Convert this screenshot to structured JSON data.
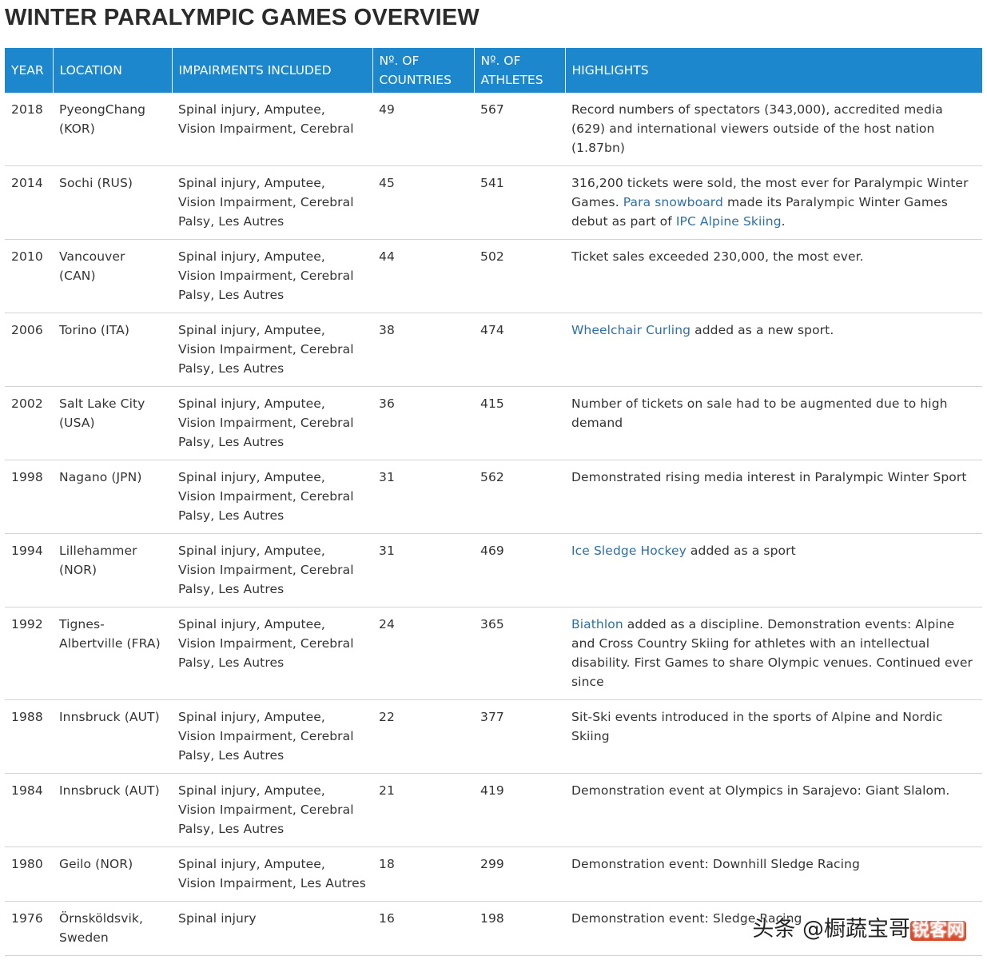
{
  "page": {
    "title": "WINTER PARALYMPIC GAMES OVERVIEW"
  },
  "table": {
    "headers": {
      "year": "YEAR",
      "location": "LOCATION",
      "impairments": "IMPAIRMENTS INCLUDED",
      "countries_line1": "Nº. OF",
      "countries_line2": "COUNTRIES",
      "athletes_line1": "Nº. OF",
      "athletes_line2": "ATHLETES",
      "highlights": "HIGHLIGHTS"
    },
    "rows": [
      {
        "year": "2018",
        "location": "PyeongChang (KOR)",
        "impairments": "Spinal injury, Amputee, Vision Impairment, Cerebral",
        "countries": "49",
        "athletes": "567",
        "highlight": [
          {
            "text": "Record numbers of spectators (343,000), accredited media (629) and international viewers outside of the host nation (1.87bn)",
            "link": false
          }
        ]
      },
      {
        "year": "2014",
        "location": "Sochi (RUS)",
        "impairments": "Spinal injury, Amputee, Vision Impairment, Cerebral Palsy, Les Autres",
        "countries": "45",
        "athletes": "541",
        "highlight": [
          {
            "text": "316,200 tickets were sold, the most ever for Paralympic Winter Games. ",
            "link": false
          },
          {
            "text": "Para snowboard",
            "link": true
          },
          {
            "text": " made its Paralympic Winter Games debut as part of ",
            "link": false
          },
          {
            "text": "IPC Alpine Skiing",
            "link": true
          },
          {
            "text": ".",
            "link": false
          }
        ]
      },
      {
        "year": "2010",
        "location": "Vancouver (CAN)",
        "impairments": "Spinal injury, Amputee, Vision Impairment, Cerebral Palsy, Les Autres",
        "countries": "44",
        "athletes": "502",
        "highlight": [
          {
            "text": "Ticket sales exceeded 230,000, the most ever.",
            "link": false
          }
        ]
      },
      {
        "year": "2006",
        "location": "Torino (ITA)",
        "impairments": "Spinal injury, Amputee, Vision Impairment, Cerebral Palsy, Les Autres",
        "countries": "38",
        "athletes": "474",
        "highlight": [
          {
            "text": "Wheelchair Curling",
            "link": true
          },
          {
            "text": " added as a new sport.",
            "link": false
          }
        ]
      },
      {
        "year": "2002",
        "location": "Salt Lake City (USA)",
        "impairments": "Spinal injury, Amputee, Vision Impairment, Cerebral Palsy, Les Autres",
        "countries": "36",
        "athletes": "415",
        "highlight": [
          {
            "text": "Number of tickets on sale had to be augmented due to high demand",
            "link": false
          }
        ]
      },
      {
        "year": "1998",
        "location": "Nagano (JPN)",
        "impairments": "Spinal injury, Amputee, Vision Impairment, Cerebral Palsy, Les Autres",
        "countries": "31",
        "athletes": "562",
        "highlight": [
          {
            "text": "Demonstrated rising media interest in Paralympic Winter Sport",
            "link": false
          }
        ]
      },
      {
        "year": "1994",
        "location": "Lillehammer (NOR)",
        "impairments": "Spinal injury, Amputee, Vision Impairment, Cerebral Palsy, Les Autres",
        "countries": "31",
        "athletes": "469",
        "highlight": [
          {
            "text": "Ice Sledge Hockey",
            "link": true
          },
          {
            "text": " added as a sport",
            "link": false
          }
        ]
      },
      {
        "year": "1992",
        "location": "Tignes-Albertville (FRA)",
        "impairments": "Spinal injury, Amputee, Vision Impairment, Cerebral Palsy, Les Autres",
        "countries": "24",
        "athletes": "365",
        "highlight": [
          {
            "text": "Biathlon",
            "link": true
          },
          {
            "text": " added as a discipline. Demonstration events: Alpine and Cross Country Skiing for athletes with an intellectual disability. First Games to share Olympic venues. Continued ever since",
            "link": false
          }
        ]
      },
      {
        "year": "1988",
        "location": "Innsbruck (AUT)",
        "impairments": "Spinal injury, Amputee, Vision Impairment, Cerebral Palsy, Les Autres",
        "countries": "22",
        "athletes": "377",
        "highlight": [
          {
            "text": "Sit-Ski events introduced in the sports of Alpine and Nordic Skiing",
            "link": false
          }
        ]
      },
      {
        "year": "1984",
        "location": "Innsbruck (AUT)",
        "impairments": "Spinal injury, Amputee, Vision Impairment, Cerebral Palsy, Les Autres",
        "countries": "21",
        "athletes": "419",
        "highlight": [
          {
            "text": "Demonstration event at Olympics in Sarajevo: Giant Slalom.",
            "link": false
          }
        ]
      },
      {
        "year": "1980",
        "location": "Geilo (NOR)",
        "impairments": "Spinal injury, Amputee, Vision Impairment, Les Autres",
        "countries": "18",
        "athletes": "299",
        "highlight": [
          {
            "text": "Demonstration event: Downhill Sledge Racing",
            "link": false
          }
        ]
      },
      {
        "year": "1976",
        "location": "Örnsköldsvik, Sweden",
        "impairments": "Spinal injury",
        "countries": "16",
        "athletes": "198",
        "highlight": [
          {
            "text": "Demonstration event: Sledge Racing",
            "link": false
          }
        ]
      }
    ]
  },
  "watermark": {
    "text": "头条 @橱蔬宝哥",
    "badge": "锐客网"
  },
  "colors": {
    "header_bg": "#1c87cd",
    "link": "#2e6fa8",
    "row_border": "#d4d4d4"
  }
}
